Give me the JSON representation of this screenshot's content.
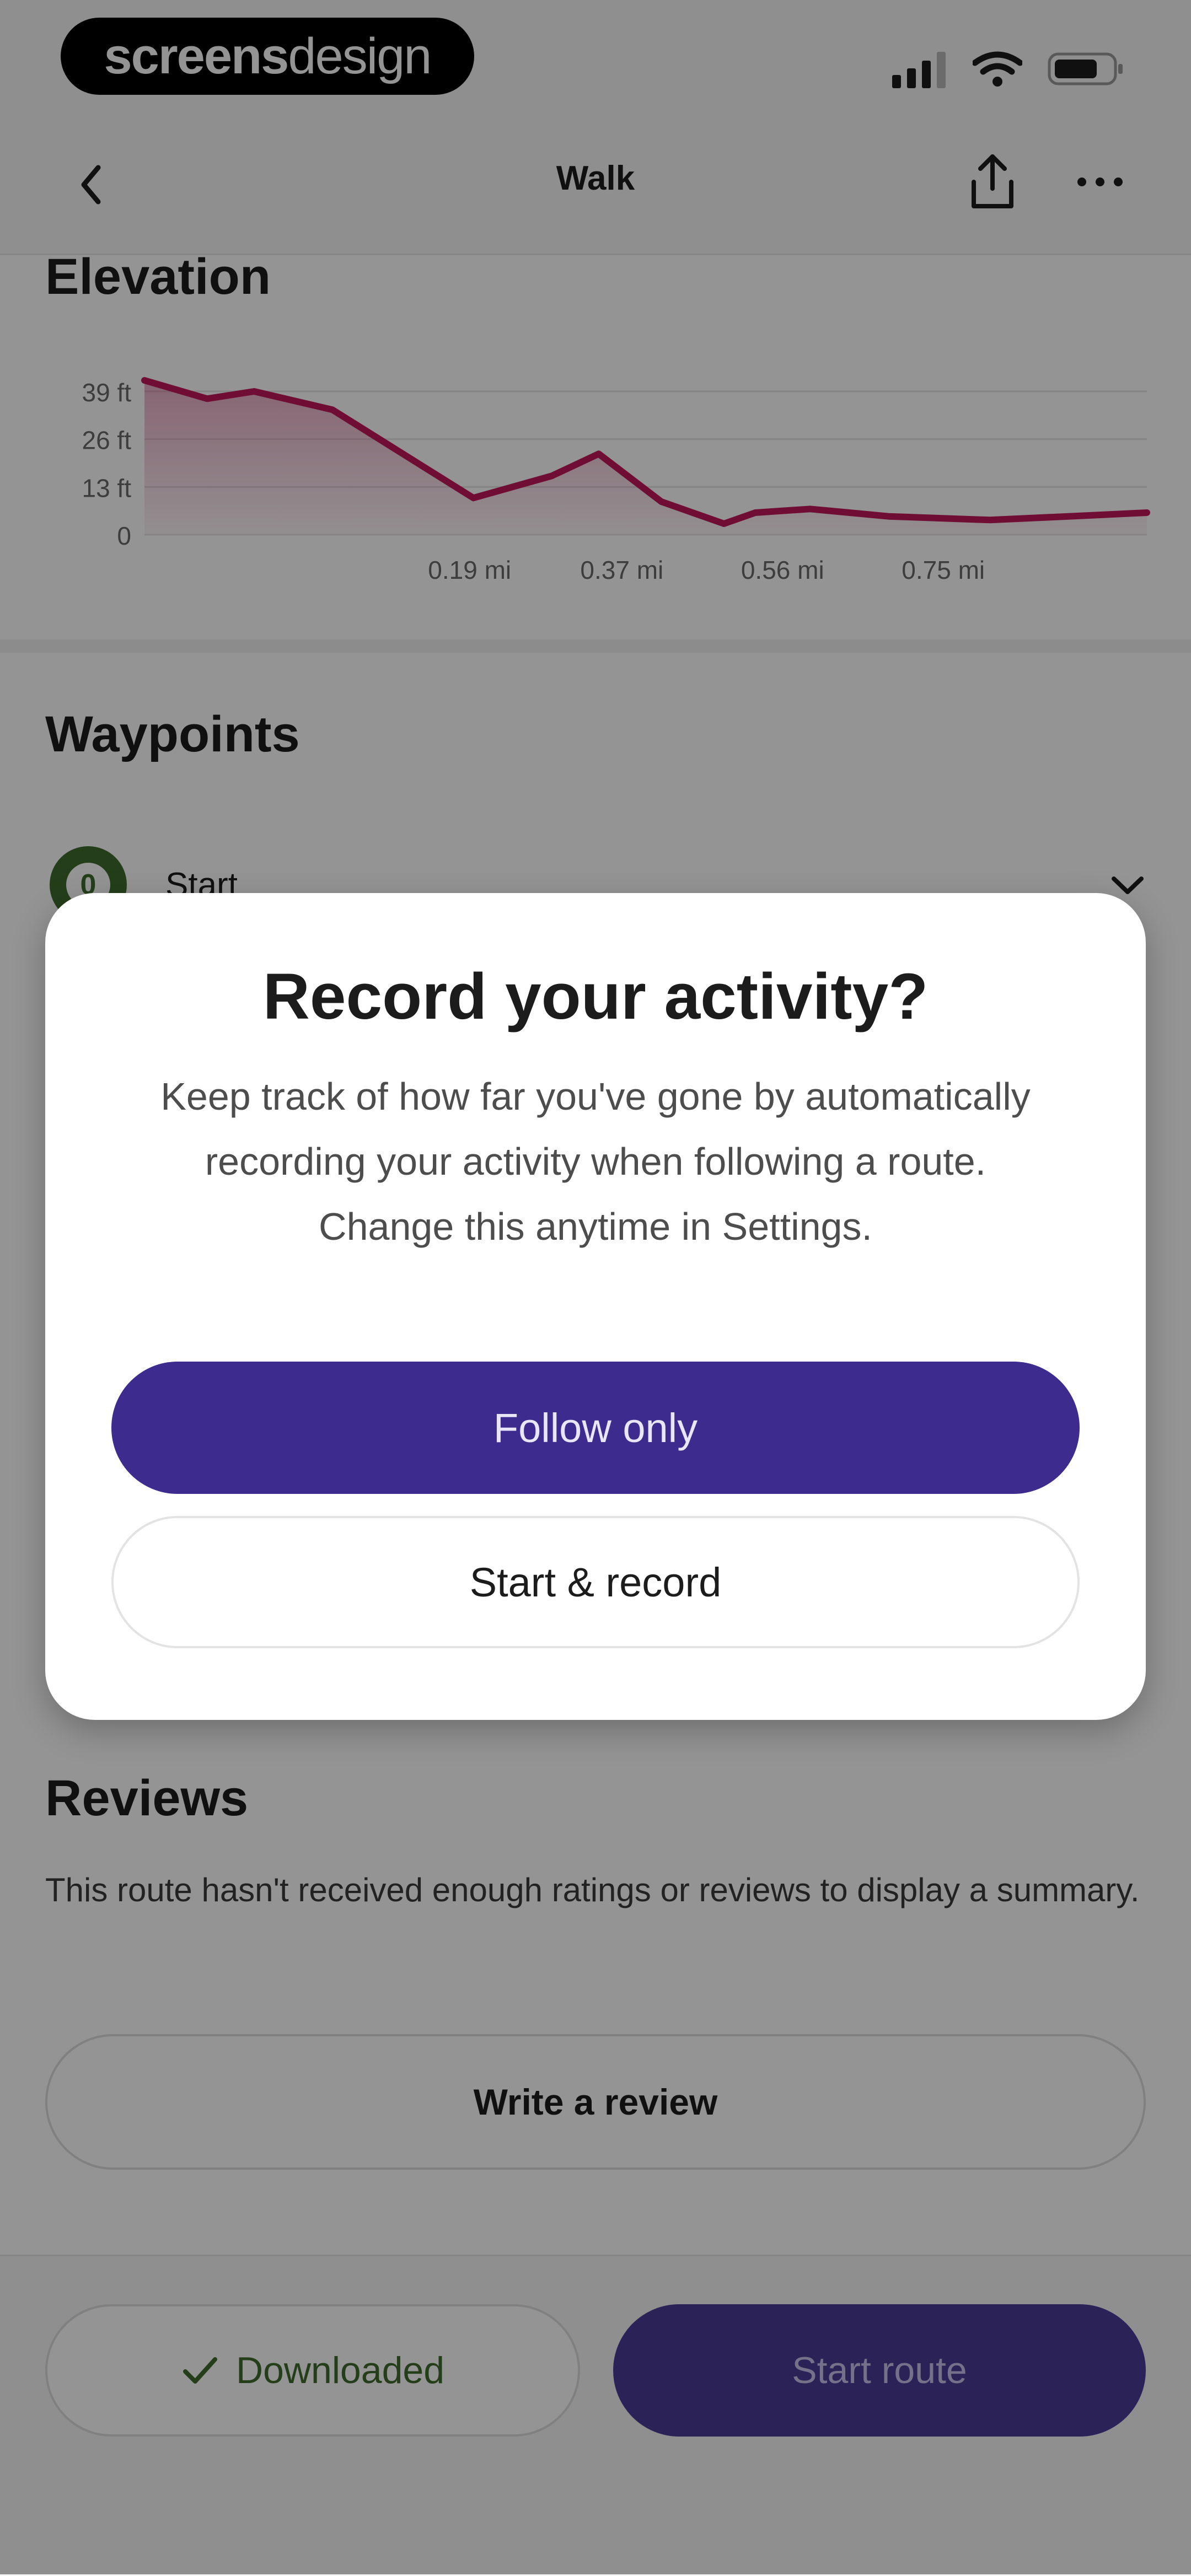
{
  "watermark": {
    "bold": "screens",
    "light": "design"
  },
  "nav": {
    "title": "Walk"
  },
  "elevation": {
    "section_title": "Elevation",
    "y_labels": [
      "39 ft",
      "26 ft",
      "13 ft",
      "0"
    ],
    "x_labels": [
      "0.19 mi",
      "0.37 mi",
      "0.56 mi",
      "0.75 mi"
    ],
    "line_color": "#c2185b"
  },
  "chart_data": {
    "type": "area",
    "title": "Elevation",
    "x": [
      0.0,
      0.08,
      0.14,
      0.24,
      0.33,
      0.42,
      0.52,
      0.58,
      0.66,
      0.74,
      0.78,
      0.85,
      0.95,
      1.08,
      1.18,
      1.28
    ],
    "y": [
      42,
      37,
      39,
      34,
      22,
      10,
      16,
      22,
      9,
      3,
      6,
      7,
      5,
      4,
      5,
      6
    ],
    "xlabel": "",
    "ylabel": "",
    "xlim": [
      0,
      1.28
    ],
    "ylim": [
      0,
      39
    ],
    "x_ticks": [
      "0.19 mi",
      "0.37 mi",
      "0.56 mi",
      "0.75 mi"
    ],
    "y_ticks": [
      "0",
      "13 ft",
      "26 ft",
      "39 ft"
    ],
    "grid": true,
    "color": "#c2185b"
  },
  "waypoints": {
    "section_title": "Waypoints",
    "items": [
      {
        "badge": "0",
        "label": "Start"
      }
    ]
  },
  "dialog": {
    "title": "Record your activity?",
    "body": "Keep track of how far you've gone by automatically recording your activity  when following a route. Change this anytime in Settings.",
    "primary_label": "Follow only",
    "secondary_label": "Start & record"
  },
  "reviews": {
    "section_title": "Reviews",
    "text": "This route hasn't received enough ratings or reviews to display a summary.",
    "button_label": "Write a review"
  },
  "footer": {
    "downloaded_label": "Downloaded",
    "start_label": "Start route"
  },
  "colors": {
    "primary": "#3d2c8d",
    "success": "#3f6b2d",
    "chart_line": "#c2185b"
  }
}
